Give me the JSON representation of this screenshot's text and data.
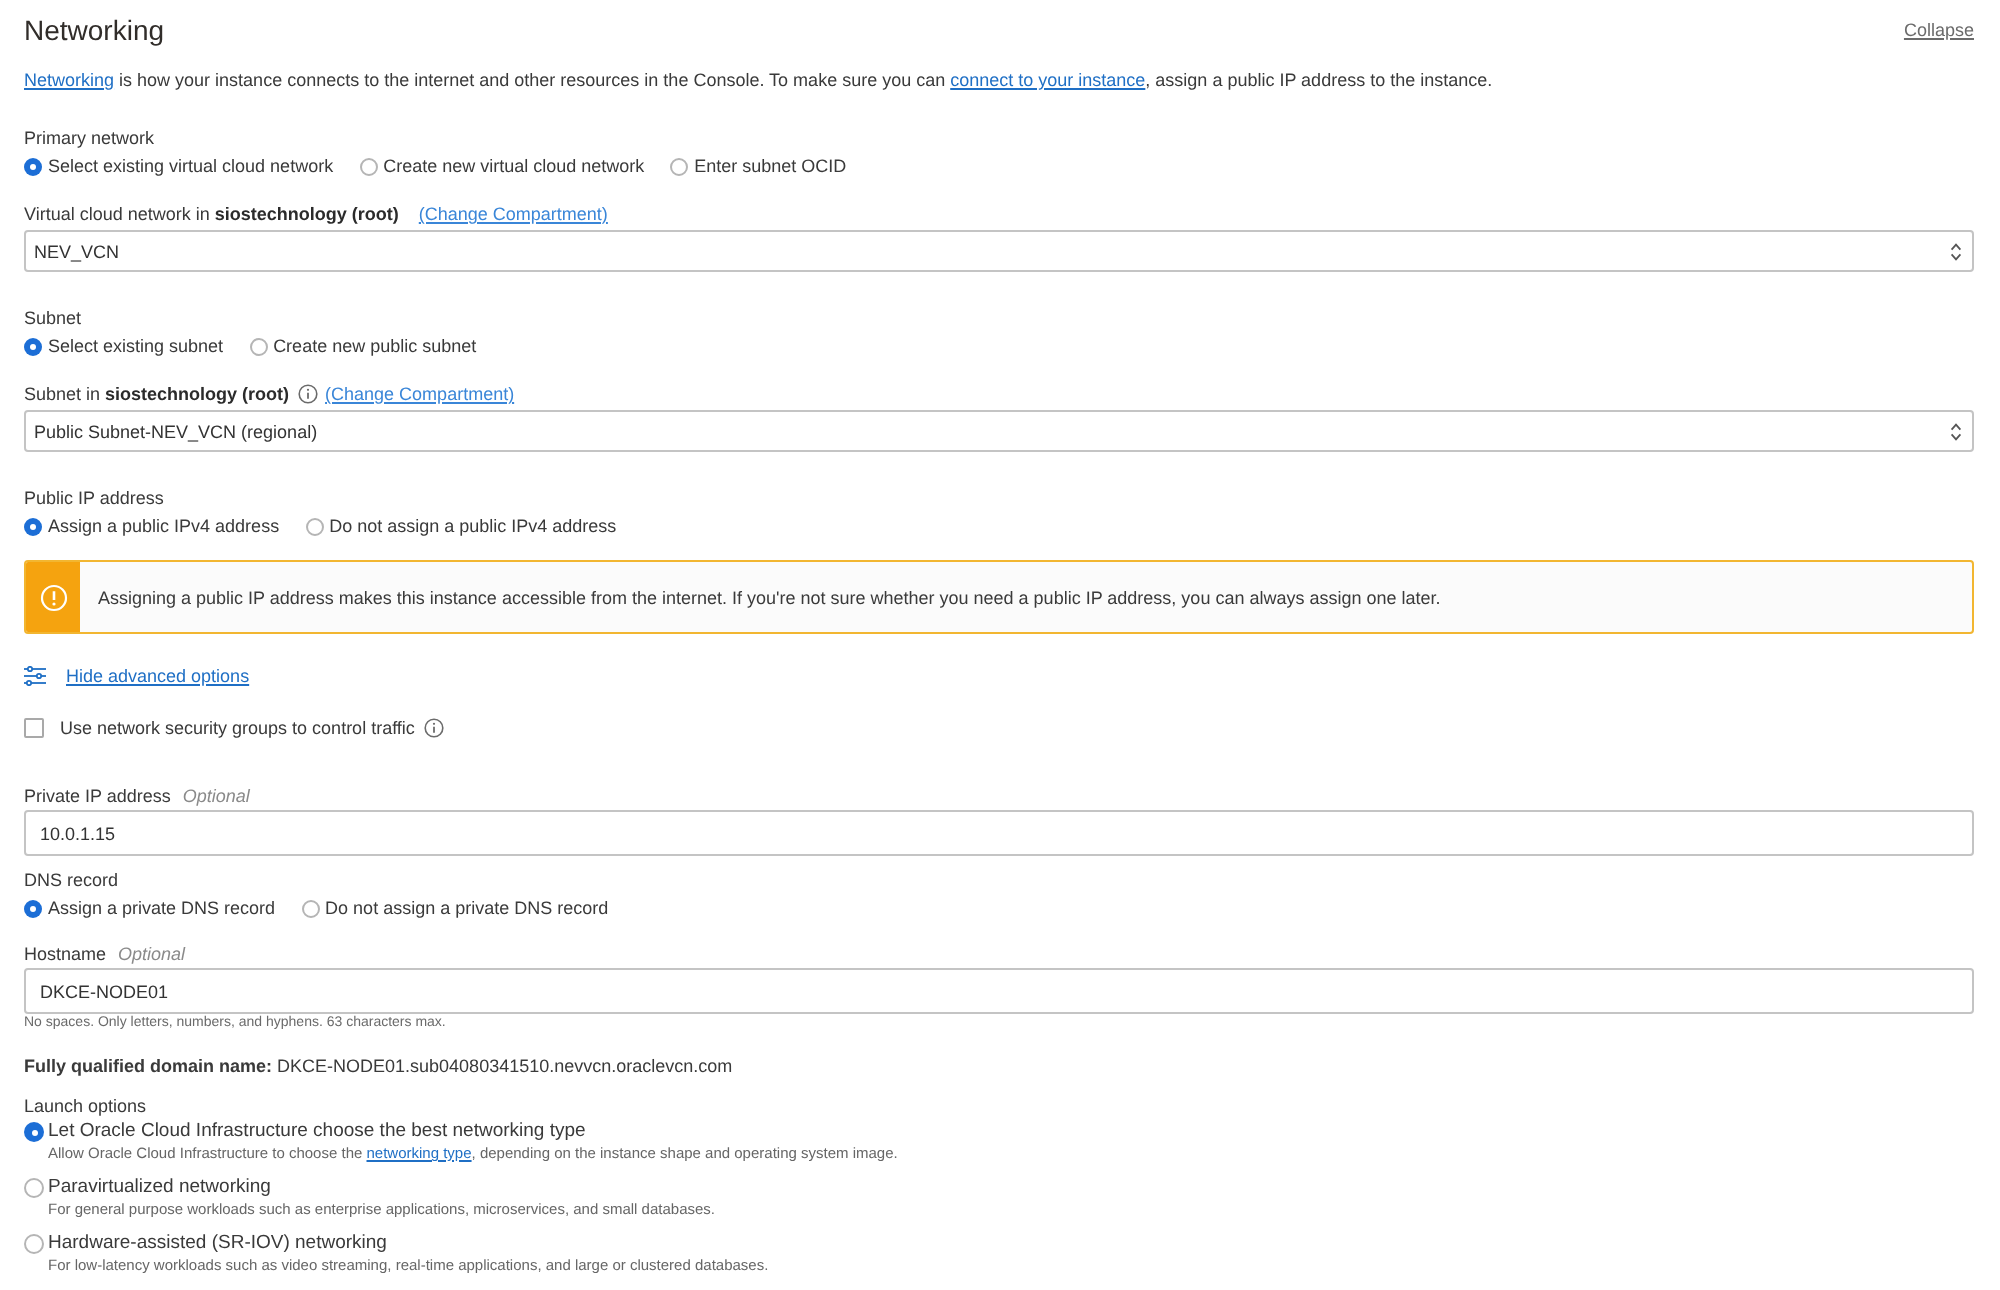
{
  "section": {
    "title": "Networking",
    "collapse": "Collapse"
  },
  "intro": [
    {
      "kind": "link",
      "text": "Networking"
    },
    {
      "kind": "text",
      "text": " is how your instance connects to the internet and other resources in the Console. To make sure you can "
    },
    {
      "kind": "link",
      "text": "connect to your instance"
    },
    {
      "kind": "text",
      "text": ", assign a public IP address to the instance."
    }
  ],
  "fields": [
    {
      "kind": "radio_group",
      "label": "Primary network",
      "options": [
        {
          "label": "Select existing virtual cloud network",
          "selected": true
        },
        {
          "label": "Create new virtual cloud network",
          "selected": false
        },
        {
          "label": "Enter subnet OCID",
          "selected": false
        }
      ]
    },
    {
      "kind": "select",
      "label": "Virtual cloud network in **siostechnology (root)**",
      "info_icon": false,
      "link": "(Change Compartment)",
      "value": "NEV_VCN"
    },
    {
      "kind": "radio_group",
      "label": "Subnet",
      "options": [
        {
          "label": "Select existing subnet",
          "selected": true
        },
        {
          "label": "Create new public subnet",
          "selected": false
        }
      ]
    },
    {
      "kind": "select",
      "label": "Subnet in **siostechnology (root)**",
      "info_icon": true,
      "link": "(Change Compartment)",
      "value": "Public Subnet-NEV_VCN (regional)"
    },
    {
      "kind": "radio_group",
      "label": "Public IP address",
      "options": [
        {
          "label": "Assign a public IPv4 address",
          "selected": true
        },
        {
          "label": "Do not assign a public IPv4 address",
          "selected": false
        }
      ]
    },
    {
      "kind": "warning",
      "text": "Assigning a public IP address makes this instance accessible from the internet. If you're not sure whether you need a public IP address, you can always assign one later."
    },
    {
      "kind": "advanced_toggle",
      "text": "Hide advanced options"
    },
    {
      "kind": "checkbox",
      "label": "Use network security groups to control traffic",
      "checked": false,
      "info_icon": true
    },
    {
      "kind": "text_input",
      "label": "Private IP address",
      "optional": "Optional",
      "value": "10.0.1.15"
    },
    {
      "kind": "radio_group",
      "label": "DNS record",
      "options": [
        {
          "label": "Assign a private DNS record",
          "selected": true
        },
        {
          "label": "Do not assign a private DNS record",
          "selected": false
        }
      ]
    },
    {
      "kind": "text_input",
      "label": "Hostname",
      "optional": "Optional",
      "value": "DKCE-NODE01",
      "hint": "No spaces. Only letters, numbers, and hyphens. 63 characters max."
    },
    {
      "kind": "info_text",
      "text": "**Fully qualified domain name:** DKCE-NODE01.sub04080341510.nevvcn.oraclevcn.com"
    },
    {
      "kind": "radio_list",
      "label": "Launch options",
      "options": [
        {
          "label": "Let Oracle Cloud Infrastructure choose the best networking type",
          "selected": true,
          "description": [
            {
              "kind": "text",
              "text": "Allow Oracle Cloud Infrastructure to choose the "
            },
            {
              "kind": "link",
              "text": "networking type"
            },
            {
              "kind": "text",
              "text": ", depending on the instance shape and operating system image."
            }
          ]
        },
        {
          "label": "Paravirtualized networking",
          "selected": false,
          "description": [
            {
              "kind": "text",
              "text": "For general purpose workloads such as enterprise applications, microservices, and small databases."
            }
          ]
        },
        {
          "label": "Hardware-assisted (SR-IOV) networking",
          "selected": false,
          "description": [
            {
              "kind": "text",
              "text": "For low-latency workloads such as video streaming, real-time applications, and large or clustered databases."
            }
          ]
        }
      ]
    }
  ]
}
